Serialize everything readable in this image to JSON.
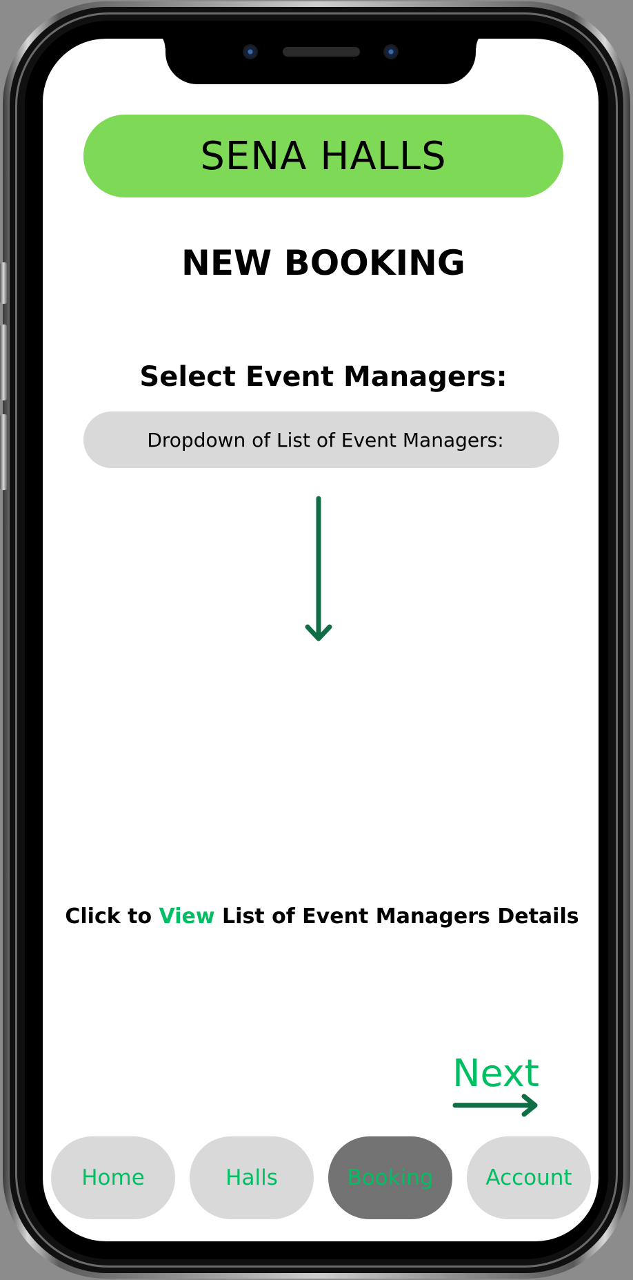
{
  "app": {
    "brand_title": "SENA HALLS",
    "page_title": "NEW BOOKING"
  },
  "event_managers": {
    "section_label": "Select Event Managers:",
    "dropdown_placeholder": "Dropdown of List of Event Managers:"
  },
  "details_prompt": {
    "prefix": "Click to ",
    "link": "View",
    "suffix": " List of Event Managers Details"
  },
  "next": {
    "label": "Next"
  },
  "bottom_nav": {
    "items": [
      {
        "label": "Home",
        "active": false
      },
      {
        "label": "Halls",
        "active": false
      },
      {
        "label": "Booking",
        "active": true
      },
      {
        "label": "Account",
        "active": false
      }
    ]
  },
  "colors": {
    "header_green": "#7ed957",
    "accent_green": "#00bf63",
    "arrow_green": "#0f6e45",
    "pill_gray": "#d9d9d9",
    "active_pill_gray": "#737373"
  },
  "icons": {
    "down_arrow": "arrow-down-icon",
    "next_arrow": "arrow-right-icon"
  }
}
